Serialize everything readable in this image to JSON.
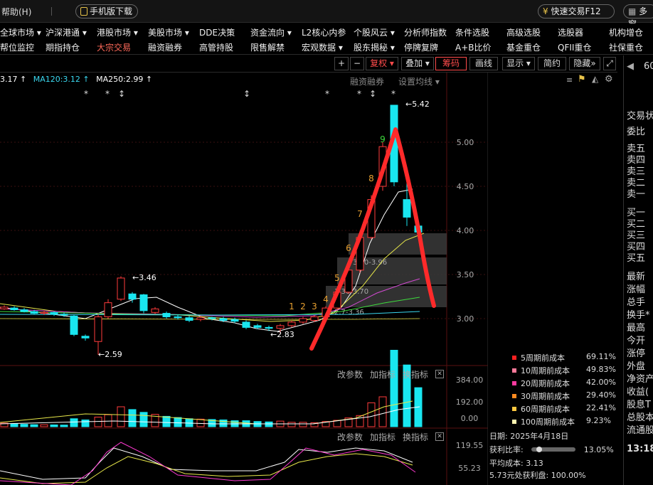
{
  "topbar": {
    "help": "帮助(H)",
    "mobile_download": "手机版下载",
    "fast_trade": "快速交易F12",
    "multi": "多窗"
  },
  "nav": {
    "row1": [
      "全球市场 ▾",
      "沪深港通 ▾",
      "港股市场 ▾",
      "美股市场 ▾",
      "DDE决策",
      "资金流向 ▾",
      "L2核心内参",
      "个股风云 ▾",
      "分析师指数",
      "条件选股",
      "高级选股",
      "选股器",
      "机构增仓"
    ],
    "row2": [
      "帮位监控",
      "期指持仓",
      "大宗交易",
      "融资融券",
      "高管持股",
      "限售解禁",
      "宏观数据 ▾",
      "股东揭秘 ▾",
      "停牌复牌",
      "A+B比价",
      "基金重仓",
      "QFII重仓",
      "社保重仓"
    ],
    "row2_highlight_index": 2
  },
  "toolbar": {
    "plus": "+",
    "minus": "−",
    "fuquan": "复权 ▾",
    "diejia": "叠加 ▾",
    "chouma": "筹码",
    "huaxian": "画线",
    "xianshi": "显示 ▾",
    "jianyue": "简约",
    "yincang": "隐藏",
    "more": "»",
    "expand": "⤢"
  },
  "ma_line": {
    "ma_short": "3.17 ↑",
    "ma120": "MA120:3.12 ↑",
    "ma250": "MA250:2.99 ↑",
    "rzrq": "融资融券",
    "set_ma": "设置均线 ▾"
  },
  "chart": {
    "price_axis": [
      "5.00",
      "4.50",
      "4.00",
      "3.50",
      "3.00"
    ],
    "annotations": {
      "high": "5.42",
      "peak_mid": "3.46",
      "low": "2.59",
      "low2": "2.83"
    },
    "seq_labels": [
      "1",
      "2",
      "3",
      "4",
      "5",
      "6",
      "7",
      "8",
      "9"
    ],
    "chip_bands": [
      "3.70-3.96",
      "3.36-3.70",
      "2.7-3.36"
    ],
    "colors": {
      "up": "#ff3b3b",
      "down": "#19e6f0",
      "ma5": "#ffffff",
      "ma10": "#e8e84a",
      "ma20": "#d24ad2",
      "ma60": "#3ddc3d",
      "draw": "#ff2a2a"
    }
  },
  "volume_panel": {
    "change_params": "改参数",
    "add_indicator": "加指标",
    "switch_indicator": "换指标",
    "close": "✕",
    "axis": [
      "384.00",
      "192.00",
      "0.00"
    ]
  },
  "indicator_panel": {
    "change_params": "改参数",
    "add_indicator": "加指标",
    "switch_indicator": "换指标",
    "close": "✕",
    "axis": [
      "119.55",
      "55.23"
    ]
  },
  "chip_legend": [
    {
      "label": "5周期前成本",
      "pct": "69.11%",
      "color": "#ff2020"
    },
    {
      "label": "10周期前成本",
      "pct": "49.83%",
      "color": "#ff7a9a"
    },
    {
      "label": "20周期前成本",
      "pct": "42.00%",
      "color": "#ff3aa0"
    },
    {
      "label": "30周期前成本",
      "pct": "29.40%",
      "color": "#ff8a20"
    },
    {
      "label": "60周期前成本",
      "pct": "22.41%",
      "color": "#ffc840"
    },
    {
      "label": "100周期前成本",
      "pct": "9.23%",
      "color": "#fff5b0"
    }
  ],
  "chip_info": {
    "date": "日期: 2025年4月18日",
    "profit_ratio_label": "获利比率:",
    "profit_ratio": "13.05%",
    "profit_ratio_fraction": 0.13,
    "avg_cost": "平均成本: 3.13",
    "profit_at": "5.73元处获利盘: 100.00%"
  },
  "right_panel": {
    "top_code": "60",
    "back_arrow": "◀",
    "items": [
      "交易状",
      "委比",
      "卖五",
      "卖四",
      "卖三",
      "卖二",
      "卖一",
      "买一",
      "买二",
      "买三",
      "买四",
      "买五",
      "最新",
      "涨幅",
      "总手",
      "换手*",
      "最高",
      "今开",
      "涨停",
      "外盘",
      "净资产",
      "收益(",
      "股息T",
      "总股本",
      "流通股"
    ],
    "time": "13:18"
  }
}
